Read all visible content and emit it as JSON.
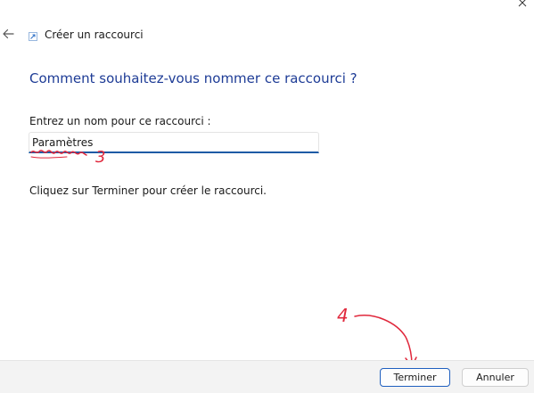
{
  "window": {
    "title": "Créer un raccourci",
    "close_icon": "close-icon",
    "back_icon": "back-arrow-icon",
    "title_icon": "shortcut-icon"
  },
  "main": {
    "heading": "Comment souhaitez-vous nommer ce raccourci ?",
    "field_label": "Entrez un nom pour ce raccourci :",
    "name_value": "Paramètres",
    "hint": "Cliquez sur Terminer pour créer le raccourci."
  },
  "annotations": {
    "step_3_label": "3",
    "step_4_label": "4",
    "color": "#e0283c"
  },
  "footer": {
    "finish_label": "Terminer",
    "cancel_label": "Annuler"
  },
  "colors": {
    "heading": "#1e3c96",
    "input_focus_underline": "#1d5ba5",
    "primary_button_border": "#1f5fbf",
    "footer_background": "#f3f3f3"
  }
}
